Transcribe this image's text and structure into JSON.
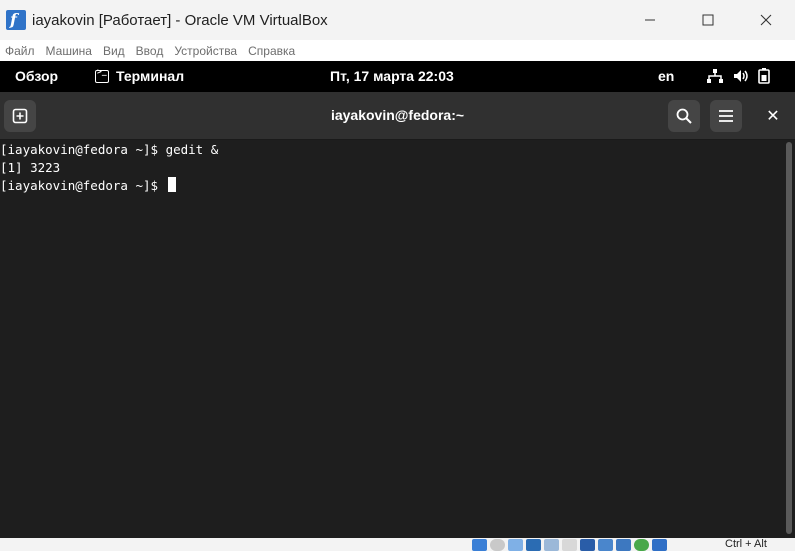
{
  "window": {
    "icon": "virtualbox-icon",
    "title": "iayakovin [Работает] - Oracle VM VirtualBox",
    "controls": [
      "minimize-icon",
      "maximize-icon",
      "close-icon"
    ]
  },
  "menubar": {
    "items": [
      "Файл",
      "Машина",
      "Вид",
      "Ввод",
      "Устройства",
      "Справка"
    ]
  },
  "gnome_topbar": {
    "overview": "Обзор",
    "active_app": "Терминал",
    "active_app_icon": "terminal-icon",
    "clock": "Пт, 17 марта  22:03",
    "language": "en",
    "tray_icons": [
      "network-icon",
      "volume-icon",
      "battery-icon"
    ]
  },
  "terminal": {
    "new_tab_icon": "new-tab-icon",
    "title": "iayakovin@fedora:~",
    "search_icon": "search-icon",
    "menu_icon": "hamburger-menu-icon",
    "close_label": "✕",
    "lines": [
      "[iayakovin@fedora ~]$ gedit &",
      "[1] 3223",
      "[iayakovin@fedora ~]$ "
    ],
    "colors": {
      "background": "#1e1e1e",
      "text": "#ffffff",
      "header": "#303030"
    }
  },
  "statusbar": {
    "host_key": "Ctrl + Alt",
    "icons": [
      "hdd-icon",
      "optical-icon",
      "usb-icon",
      "network-adapter-icon",
      "usb-device-icon",
      "shared-folders-icon",
      "display-icon",
      "video-capture-icon",
      "recording-icon",
      "cpu-icon",
      "mouse-integration-icon",
      "keyboard-capture-icon"
    ]
  }
}
